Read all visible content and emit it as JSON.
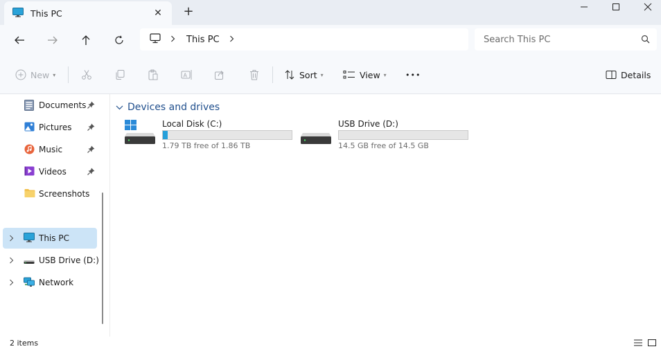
{
  "window": {
    "tab_title": "This PC",
    "new_tab_symbol": "+",
    "close_tab_symbol": "✕"
  },
  "address": {
    "crumbs": [
      "This PC"
    ],
    "search_placeholder": "Search This PC"
  },
  "commands": {
    "new_label": "New",
    "sort_label": "Sort",
    "view_label": "View",
    "more_label": "•••",
    "details_label": "Details"
  },
  "sidebar": {
    "quick_access": [
      {
        "label": "Documents",
        "icon": "documents-icon",
        "pinned": true
      },
      {
        "label": "Pictures",
        "icon": "pictures-icon",
        "pinned": true
      },
      {
        "label": "Music",
        "icon": "music-icon",
        "pinned": true
      },
      {
        "label": "Videos",
        "icon": "videos-icon",
        "pinned": true
      },
      {
        "label": "Screenshots",
        "icon": "folder-icon",
        "pinned": false
      }
    ],
    "locations": [
      {
        "label": "This PC",
        "icon": "this-pc-icon",
        "selected": true
      },
      {
        "label": "USB Drive (D:)",
        "icon": "usb-drive-icon",
        "selected": false
      },
      {
        "label": "Network",
        "icon": "network-icon",
        "selected": false
      }
    ]
  },
  "content": {
    "group_title": "Devices and drives",
    "drives": [
      {
        "name": "Local Disk (C:)",
        "free_text": "1.79 TB free of 1.86 TB",
        "used_fraction": 0.038
      },
      {
        "name": "USB Drive (D:)",
        "free_text": "14.5 GB free of 14.5 GB",
        "used_fraction": 0.0
      }
    ]
  },
  "status": {
    "item_count": "2 items"
  },
  "colors": {
    "accent": "#26a0da",
    "selection": "#cce4f7",
    "group_title": "#1f4e8c"
  }
}
